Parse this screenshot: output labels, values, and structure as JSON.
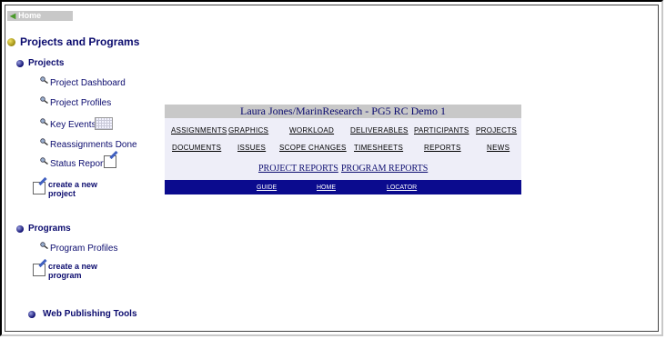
{
  "home_button": {
    "label": "Home"
  },
  "section_title": "Projects and Programs",
  "projects": {
    "heading": "Projects",
    "links": [
      "Project Dashboard",
      "Project Profiles",
      "Key Events",
      "Reassignments Done",
      "Status Reports"
    ],
    "create_line1": "create a new",
    "create_line2": "project"
  },
  "programs": {
    "heading": "Programs",
    "links": [
      "Program Profiles"
    ],
    "create_line1": "create a new",
    "create_line2": "program"
  },
  "web_tools": {
    "heading": "Web Publishing Tools"
  },
  "menu_panel": {
    "title": "Laura Jones/MarinResearch - PG5 RC Demo 1",
    "row1": [
      "ASSIGNMENTS",
      "GRAPHICS",
      "WORKLOAD",
      "DELIVERABLES",
      "PARTICIPANTS",
      "PROJECTS"
    ],
    "row2": [
      "DOCUMENTS",
      "ISSUES",
      "SCOPE CHANGES",
      "TIMESHEETS",
      "REPORTS",
      "NEWS"
    ],
    "reports": [
      "PROJECT REPORTS",
      "PROGRAM REPORTS"
    ],
    "footer": [
      "GUIDE",
      "HOME",
      "LOCATOR"
    ]
  },
  "colors": {
    "link": "#0b0b6e",
    "footer_bar": "#0b0b8e",
    "title_bar": "#c8c8c8",
    "panel_bg": "#eeeef8"
  },
  "icons": [
    "arrow-left-icon",
    "olive-bullet-icon",
    "blue-bullet-icon",
    "magnifier-icon",
    "calendar-grid-icon",
    "notepad-pen-icon"
  ]
}
